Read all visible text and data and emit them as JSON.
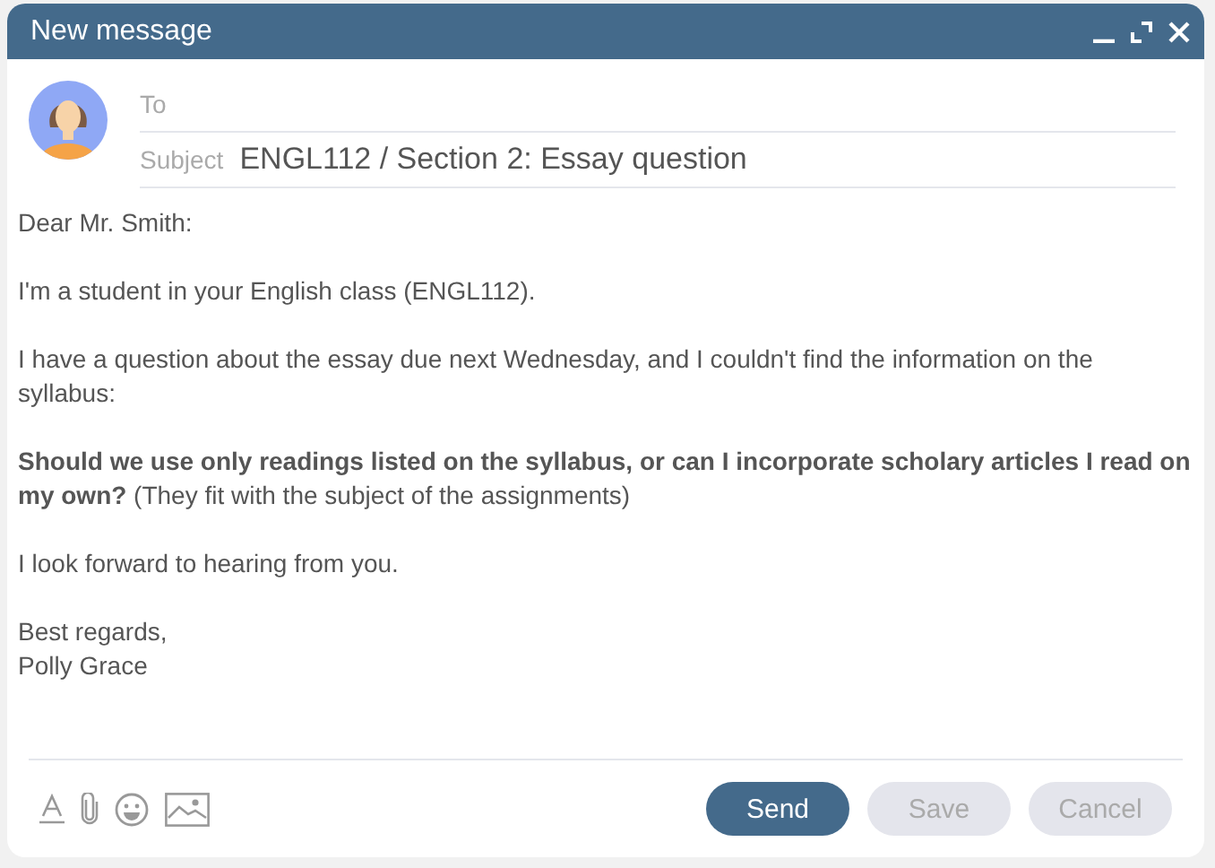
{
  "window": {
    "title": "New message"
  },
  "header": {
    "to": {
      "label": "To"
    },
    "subject": {
      "label": "Subject",
      "value": "ENGL112 / Section 2: Essay question"
    }
  },
  "body": {
    "paragraphs": [
      {
        "lines": [
          "Dear Mr. Smith:"
        ]
      },
      {
        "lines": [
          "I'm a student in your English class (ENGL112)."
        ]
      },
      {
        "lines": [
          "I have a question about the essay due next Wednesday, and I couldn't find the information on the syllabus:"
        ]
      },
      {
        "lines": [
          "**Should we use only readings listed on the syllabus, or can I incorporate scholary articles I read on my own?** (They fit with the subject of the assignments)"
        ]
      },
      {
        "lines": [
          "I look forward to hearing from you."
        ]
      },
      {
        "lines": [
          "Best regards,",
          "Polly Grace"
        ]
      }
    ]
  },
  "buttons": [
    {
      "label": "Send",
      "kind": "primary",
      "disabled": false
    },
    {
      "label": "Save",
      "kind": "secondary",
      "disabled": true
    },
    {
      "label": "Cancel",
      "kind": "secondary",
      "disabled": true
    }
  ]
}
